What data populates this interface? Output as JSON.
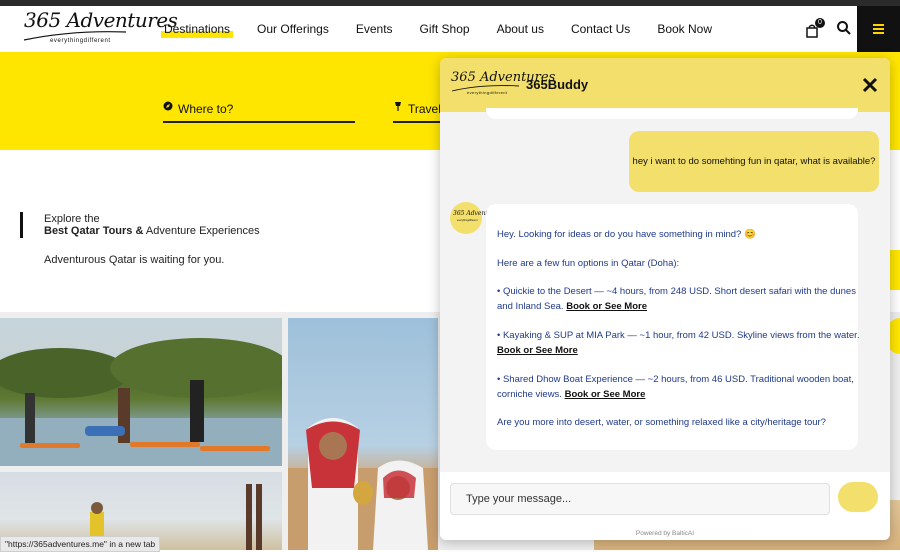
{
  "site": {
    "logo_script": "365 Adventures",
    "logo_tagline": "everythingdifferent"
  },
  "nav": {
    "items": [
      "Destinations",
      "Our Offerings",
      "Events",
      "Gift Shop",
      "About us",
      "Contact Us",
      "Book Now"
    ],
    "cart_count": "0"
  },
  "hero": {
    "where_placeholder": "Where to?",
    "travel_placeholder": "Travel"
  },
  "intro": {
    "line1": "Explore the",
    "line2_bold": "Best Qatar Tours &",
    "line2_rest": " Adventure Experiences",
    "line3": "Adventurous Qatar is waiting for you."
  },
  "status_tooltip": "\"https://365adventures.me\" in a new tab",
  "chat": {
    "title": "365Buddy",
    "logo_script": "365 Adventures",
    "logo_tagline": "everythingdifferent",
    "user_message": "hey i want to do somehting fun in qatar, what is available?",
    "bot": {
      "greeting": "Hey. Looking for ideas or do you have something in mind? 😊",
      "intro": "Here are a few fun options in Qatar (Doha):",
      "opt1_a": "• Quickie to the Desert — ~4 hours, from 248 USD. Short desert safari with the dunes",
      "opt1_b": "and Inland Sea. ",
      "opt2_a": "• Kayaking & SUP at MIA Park — ~1 hour, from 42 USD. Skyline views from the water.",
      "opt3_a": "• Shared Dhow Boat Experience — ~2 hours, from 46 USD. Traditional wooden boat,",
      "opt3_b": "corniche views. ",
      "link": "Book or See More",
      "closing": "Are you more into desert, water, or something relaxed like a city/heritage tour?"
    },
    "input_placeholder": "Type your message...",
    "powered_by": "Powered by BalticAI"
  },
  "colors": {
    "brand_yellow": "#ffe600",
    "chat_yellow": "#f3df6b",
    "bot_text": "#1f3a8a"
  }
}
